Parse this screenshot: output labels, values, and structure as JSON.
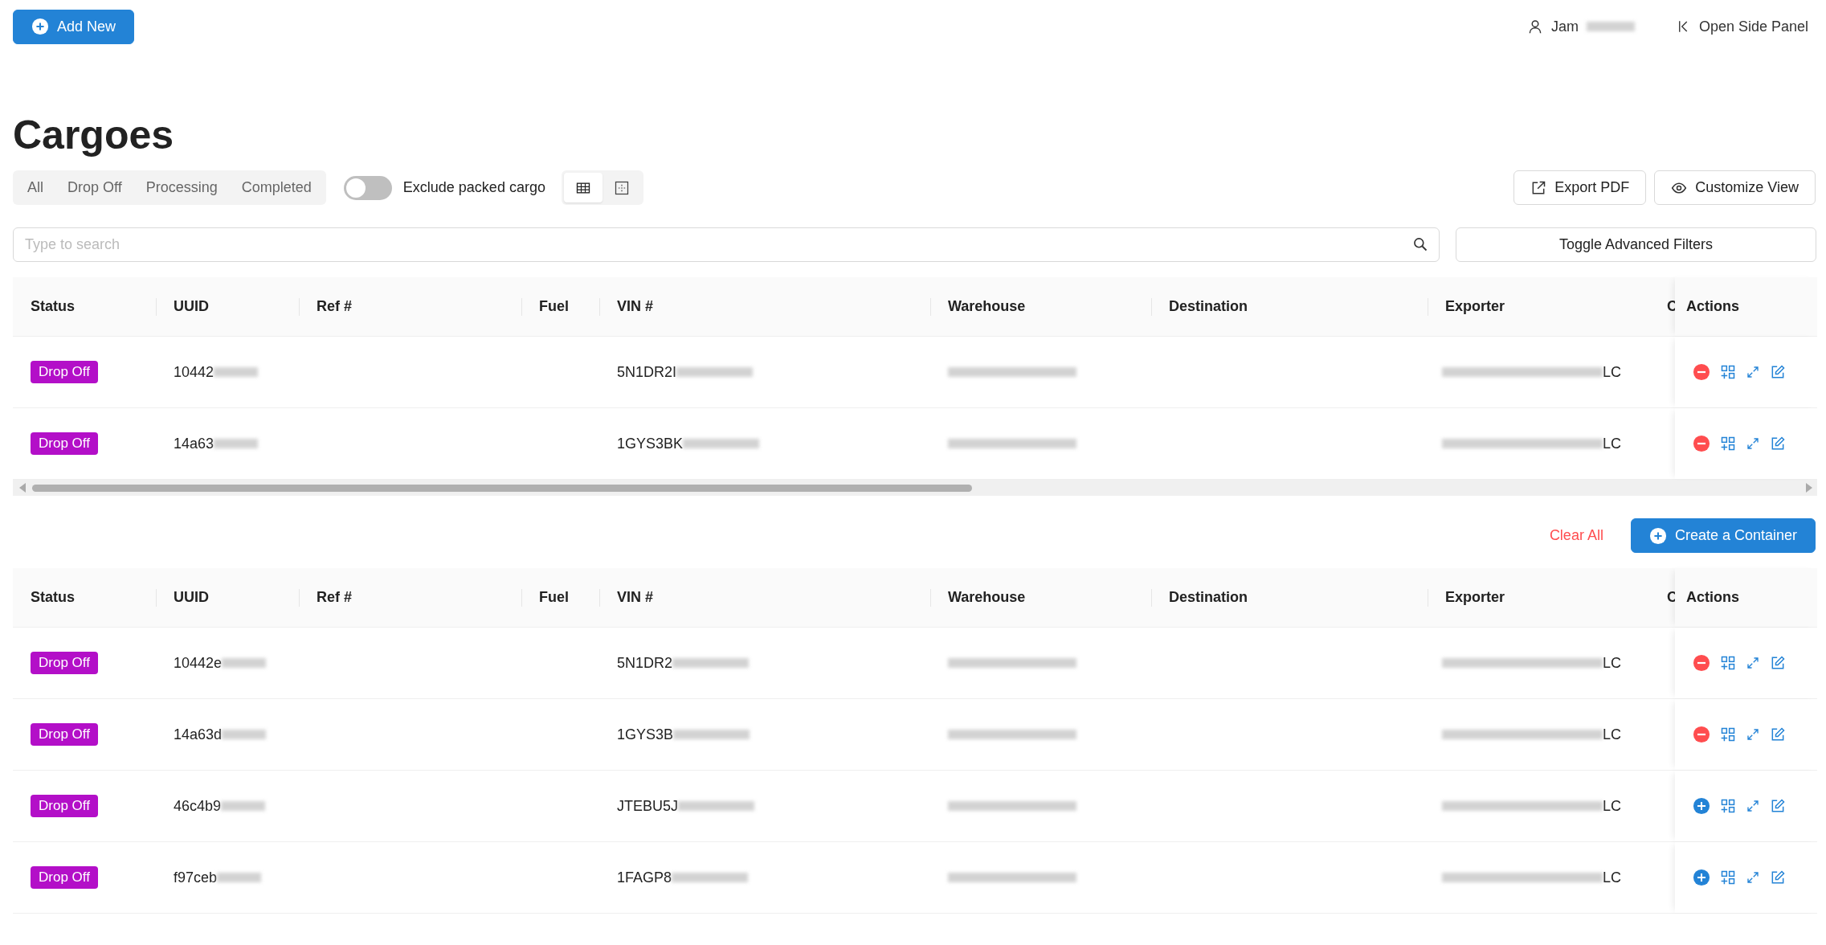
{
  "header": {
    "add_button": "Add New",
    "user_name": "Jam",
    "side_panel": "Open Side Panel"
  },
  "title": "Cargoes",
  "filters": {
    "tabs": [
      {
        "label": "All",
        "selected": false
      },
      {
        "label": "Drop Off",
        "selected": false
      },
      {
        "label": "Processing",
        "selected": false
      },
      {
        "label": "Completed",
        "selected": false
      }
    ],
    "exclude_packed": {
      "label": "Exclude packed cargo",
      "on": false
    },
    "view_modes": [
      {
        "kind": "table",
        "selected": true
      },
      {
        "kind": "grid",
        "selected": false
      }
    ],
    "export_button": "Export PDF",
    "customize_button": "Customize View"
  },
  "search": {
    "placeholder": "Type to search"
  },
  "advanced_filters_button": "Toggle Advanced Filters",
  "cargo_table": {
    "columns": [
      "Status",
      "UUID",
      "Ref #",
      "Fuel",
      "VIN #",
      "Warehouse",
      "Destination",
      "Exporter",
      "C",
      "Actions"
    ],
    "rows": [
      {
        "status": "Drop Off",
        "uuid": "10442",
        "vin": "5N1DR2I",
        "exporter": "LC",
        "kind": "remove"
      },
      {
        "status": "Drop Off",
        "uuid": "14a63",
        "vin": "1GYS3BK",
        "exporter": "LC",
        "kind": "remove"
      }
    ]
  },
  "container_bar": {
    "clear_button": "Clear All",
    "create_button": "Create a Container"
  },
  "container_table": {
    "columns": [
      "Status",
      "UUID",
      "Ref #",
      "Fuel",
      "VIN #",
      "Warehouse",
      "Destination",
      "Exporter",
      "C",
      "Actions"
    ],
    "rows": [
      {
        "status": "Drop Off",
        "uuid": "10442e",
        "vin": "5N1DR2",
        "exporter": "LC",
        "kind": "remove"
      },
      {
        "status": "Drop Off",
        "uuid": "14a63d",
        "vin": "1GYS3B",
        "exporter": "LC",
        "kind": "remove"
      },
      {
        "status": "Drop Off",
        "uuid": "46c4b9",
        "vin": "JTEBU5J",
        "exporter": "LC",
        "kind": "add"
      },
      {
        "status": "Drop Off",
        "uuid": "f97ceb",
        "vin": "1FAGP8",
        "exporter": "LC",
        "kind": "add"
      }
    ]
  }
}
